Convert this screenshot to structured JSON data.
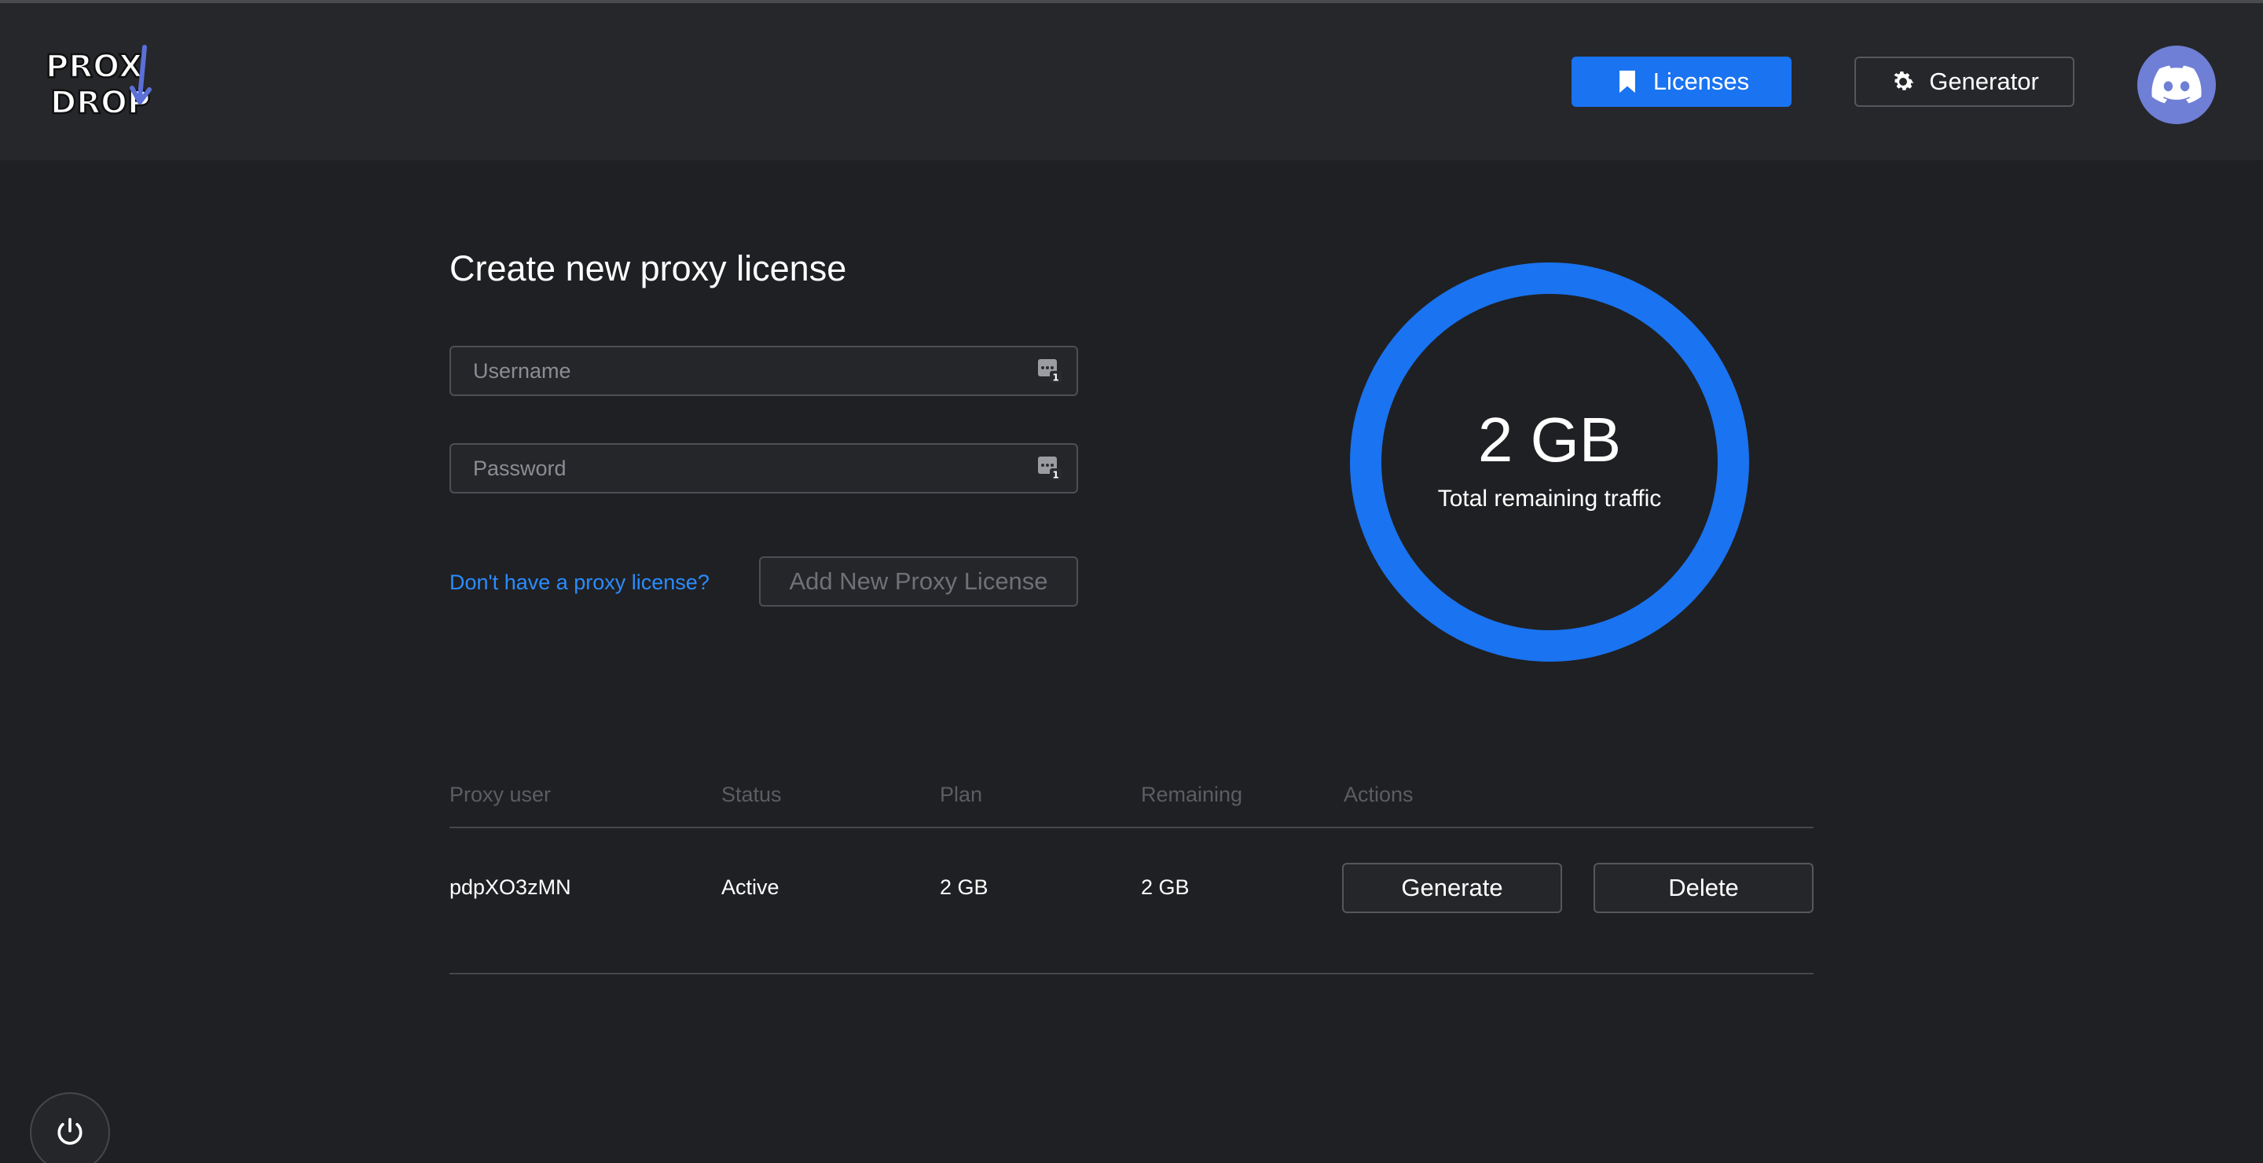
{
  "header": {
    "logo_text_line1": "PROXY",
    "logo_text_line2": "DROP",
    "nav": [
      {
        "label": "Licenses",
        "icon": "bookmark-icon",
        "active": true
      },
      {
        "label": "Generator",
        "icon": "gear-icon",
        "active": false
      }
    ],
    "avatar_icon": "discord-icon"
  },
  "form": {
    "title": "Create new proxy license",
    "username_placeholder": "Username",
    "password_placeholder": "Password",
    "no_license_link": "Don't have a proxy license?",
    "add_button": "Add New Proxy License"
  },
  "traffic": {
    "value": "2 GB",
    "label": "Total remaining traffic",
    "ring_fraction": 1.0,
    "ring_color": "#1a73f0"
  },
  "table": {
    "headers": [
      "Proxy user",
      "Status",
      "Plan",
      "Remaining",
      "Actions"
    ],
    "rows": [
      {
        "user": "pdpXO3zMN",
        "status": "Active",
        "plan": "2 GB",
        "remaining": "2 GB",
        "actions": [
          "Generate",
          "Delete"
        ]
      }
    ]
  },
  "colors": {
    "accent": "#1a73f0",
    "link": "#2a8cff",
    "background": "#1f2023",
    "header_bg": "#26272b"
  },
  "power_icon": "power-icon"
}
